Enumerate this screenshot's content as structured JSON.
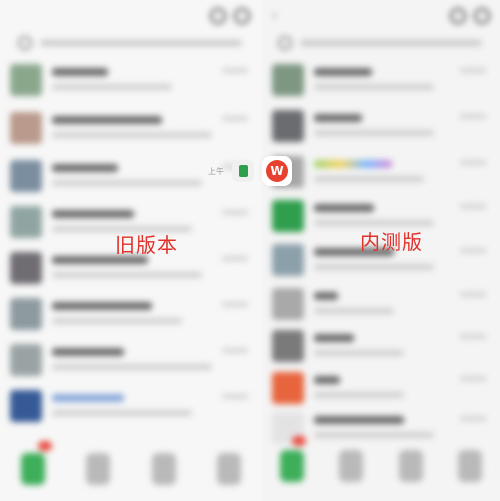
{
  "labels": {
    "left": "旧版本",
    "right": "内测版"
  },
  "floating": {
    "time_text": "上午",
    "app_letter": "W"
  },
  "colors": {
    "accent_green": "#3dae5a",
    "accent_red": "#e84a3f",
    "label_red": "#e0312a"
  },
  "icons": {
    "left_phone": [
      "search-icon",
      "more-icon"
    ],
    "right_phone": [
      "back-icon",
      "search-icon",
      "more-icon"
    ],
    "tabbar": [
      "chats-tab-icon",
      "contacts-tab-icon",
      "discover-tab-icon",
      "me-tab-icon"
    ]
  }
}
